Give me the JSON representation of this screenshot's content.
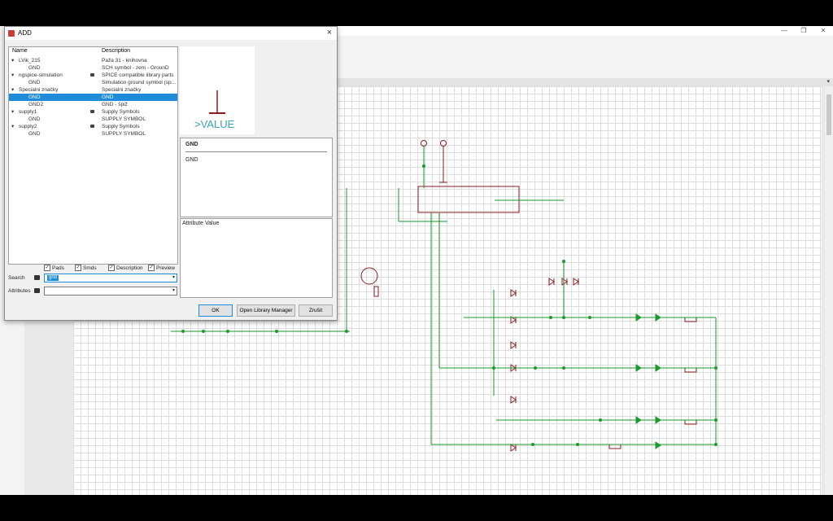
{
  "dialog": {
    "title": "ADD",
    "close": "×",
    "columns": {
      "name": "Name",
      "description": "Description"
    },
    "tree": [
      {
        "name": "LVik_215",
        "description": "Paža 31 - knihovna",
        "level": 0,
        "expanded": true
      },
      {
        "name": "GND",
        "description": "SCH symbol - zem - GrounD",
        "level": 1
      },
      {
        "name": "ngspice-simulation",
        "description": "SPICE compatible library parts",
        "level": 0,
        "expanded": true,
        "locked": true
      },
      {
        "name": "GND",
        "description": "Simulation ground symbol (sp...",
        "level": 1
      },
      {
        "name": "Specialni značky",
        "description": "Specialni značky",
        "level": 0,
        "expanded": true
      },
      {
        "name": "GND",
        "description": "GND",
        "level": 1,
        "selected": true
      },
      {
        "name": "GND2",
        "description": "GND - špiž",
        "level": 1
      },
      {
        "name": "supply1",
        "description": "Supply Symbols",
        "level": 0,
        "expanded": true,
        "locked": true
      },
      {
        "name": "GND",
        "description": "SUPPLY SYMBOL",
        "level": 1
      },
      {
        "name": "supply2",
        "description": "Supply Symbols",
        "level": 0,
        "expanded": true,
        "locked": true
      },
      {
        "name": "GND",
        "description": "SUPPLY SYMBOL",
        "level": 1
      }
    ],
    "preview_text": ">VALUE",
    "info": {
      "name": "GND",
      "description": "GND"
    },
    "attributes_header": "Attribute Value",
    "filters": {
      "pads": "Pads",
      "smds": "Smds",
      "description": "Description",
      "preview": "Preview"
    },
    "search": {
      "label": "Search",
      "value": "gnd"
    },
    "attributes": {
      "label": "Attributes",
      "value": ""
    },
    "buttons": {
      "ok": "OK",
      "library_manager": "Open Library Manager",
      "cancel": "Zrušit"
    }
  },
  "window_controls": {
    "minimize": "—",
    "maximize": "❐",
    "close": "✕"
  },
  "icons": [
    "close-icon",
    "expand-arrow-icon",
    "lock-icon",
    "tag-icon",
    "chevron-down-icon",
    "checkbox-icon"
  ]
}
